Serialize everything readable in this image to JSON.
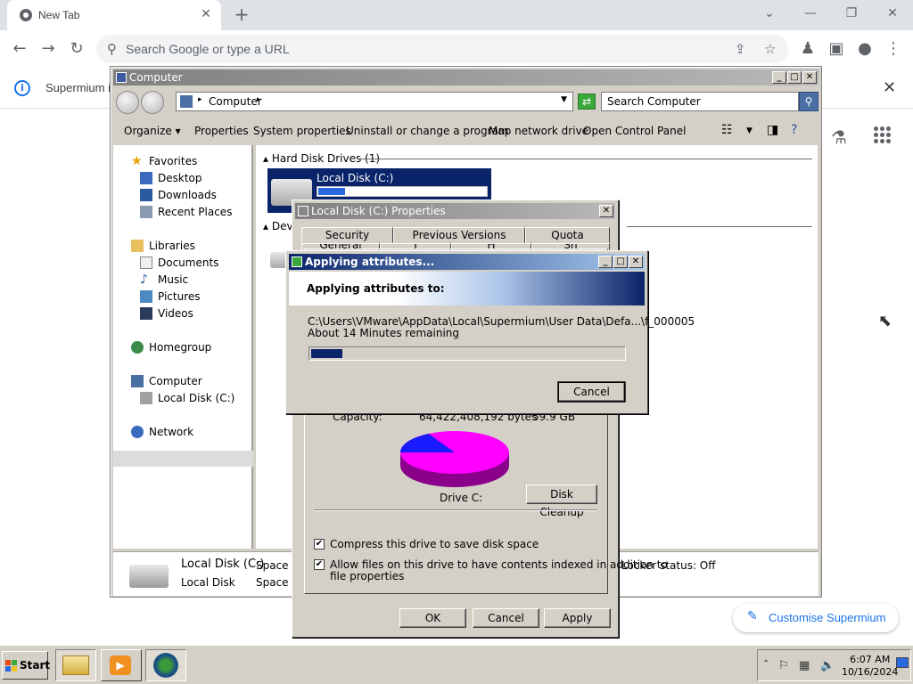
{
  "browser": {
    "tab_title": "New Tab",
    "omnibox_placeholder": "Search Google or type a URL",
    "infobar_text": "Supermium is",
    "customise_label": "Customise Supermium"
  },
  "explorer": {
    "title": "Computer",
    "address": "Computer",
    "search_placeholder": "Search Computer",
    "toolbar": {
      "organize": "Organize",
      "properties": "Properties",
      "system_properties": "System properties",
      "uninstall": "Uninstall or change a program",
      "map_drive": "Map network drive",
      "control_panel": "Open Control Panel"
    },
    "nav": {
      "favorites": "Favorites",
      "desktop": "Desktop",
      "downloads": "Downloads",
      "recent": "Recent Places",
      "libraries": "Libraries",
      "documents": "Documents",
      "music": "Music",
      "pictures": "Pictures",
      "videos": "Videos",
      "homegroup": "Homegroup",
      "computer": "Computer",
      "local_disk": "Local Disk (C:)",
      "network": "Network"
    },
    "groups": {
      "hdd": "Hard Disk Drives (1)",
      "devices": "Devic"
    },
    "drive_label": "Local Disk (C:)",
    "drive_used_fraction": 0.16,
    "details": {
      "name": "Local Disk (C:)",
      "type": "Local Disk",
      "space_used": "Space us",
      "space_free": "Space fr",
      "locker_status": "Locker status: Off"
    }
  },
  "properties": {
    "title": "Local Disk (C:) Properties",
    "tabs_top": [
      "Security",
      "Previous Versions",
      "Quota"
    ],
    "tabs_bottom": [
      "General",
      "T",
      "H",
      "Sh"
    ],
    "capacity_label": "Capacity:",
    "capacity_bytes": "64,422,408,192 bytes",
    "capacity_gb": "59.9 GB",
    "drive_caption": "Drive C:",
    "disk_cleanup": "Disk Cleanup",
    "compress_label": "Compress this drive to save disk space",
    "compress_checked": true,
    "index_label_1": "Allow files on this drive to have contents indexed in addition to",
    "index_label_2": "file properties",
    "index_checked": true,
    "ok": "OK",
    "cancel": "Cancel",
    "apply": "Apply",
    "used_fraction": 0.17
  },
  "applying": {
    "title": "Applying attributes...",
    "heading": "Applying attributes to:",
    "path": "C:\\Users\\VMware\\AppData\\Local\\Supermium\\User Data\\Defa...\\f_000005",
    "remaining": "About 14 Minutes remaining",
    "progress_fraction": 0.1,
    "cancel": "Cancel"
  },
  "taskbar": {
    "start": "Start",
    "time": "6:07 AM",
    "date": "10/16/2024"
  },
  "colors": {
    "classic_title_active": "#0a246a",
    "pie_used": "#1a1aff",
    "pie_free": "#ff00ff"
  }
}
